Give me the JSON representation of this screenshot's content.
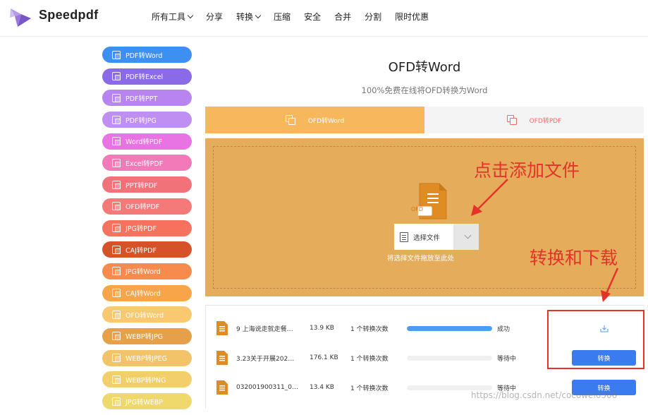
{
  "header": {
    "brand": "Speedpdf",
    "nav": [
      {
        "label": "所有工具",
        "dropdown": true
      },
      {
        "label": "分享",
        "dropdown": false
      },
      {
        "label": "转换",
        "dropdown": true
      },
      {
        "label": "压缩",
        "dropdown": false
      },
      {
        "label": "安全",
        "dropdown": false
      },
      {
        "label": "合并",
        "dropdown": false
      },
      {
        "label": "分割",
        "dropdown": false
      },
      {
        "label": "限时优惠",
        "dropdown": false
      }
    ]
  },
  "sidebar": {
    "items": [
      {
        "label": "PDF转Word",
        "color": "#3d8ff1"
      },
      {
        "label": "PDF转Excel",
        "color": "#8a6ae6"
      },
      {
        "label": "PDF转PPT",
        "color": "#b884f0"
      },
      {
        "label": "PDF转JPG",
        "color": "#bf8ff2"
      },
      {
        "label": "Word转PDF",
        "color": "#e873e3"
      },
      {
        "label": "Excel转PDF",
        "color": "#f27ab8"
      },
      {
        "label": "PPT转PDF",
        "color": "#f2727a"
      },
      {
        "label": "OFD转PDF",
        "color": "#f47a7a"
      },
      {
        "label": "JPG转PDF",
        "color": "#f6725e"
      },
      {
        "label": "CAJ转PDF",
        "color": "#d65329"
      },
      {
        "label": "JPG转Word",
        "color": "#f78a4d"
      },
      {
        "label": "CAJ转Word",
        "color": "#f7a548"
      },
      {
        "label": "OFD转Word",
        "color": "#fac870"
      },
      {
        "label": "WEBP转JPG",
        "color": "#e6a04a"
      },
      {
        "label": "WEBP转JPEG",
        "color": "#f2c368"
      },
      {
        "label": "WEBP转PNG",
        "color": "#f2cf6a"
      },
      {
        "label": "JPG转WEBP",
        "color": "#efd96c"
      }
    ]
  },
  "main": {
    "title": "OFD转Word",
    "subtitle": "100%免费在线将OFD转换为Word",
    "tabs": [
      {
        "label": "OFD转Word",
        "active": true
      },
      {
        "label": "OFD转PDF",
        "active": false
      }
    ],
    "upload": {
      "file_badge": "OFD",
      "select_label": "选择文件",
      "drop_hint": "将选择文件拖放至此处"
    }
  },
  "annotations": {
    "add_file": "点击添加文件",
    "convert_download": "转换和下载"
  },
  "files": [
    {
      "name": "9 上海说走就走餐…",
      "size": "13.9 KB",
      "count": "1 个转换次数",
      "progress": 1.0,
      "status": "成功",
      "action": "download"
    },
    {
      "name": "3.23关于开展202…",
      "size": "176.1 KB",
      "count": "1 个转换次数",
      "progress": 0.0,
      "status": "等待中",
      "action": "convert",
      "action_label": "转换"
    },
    {
      "name": "032001900311_0…",
      "size": "13.4 KB",
      "count": "1 个转换次数",
      "progress": 0.0,
      "status": "等待中",
      "action": "convert",
      "action_label": "转换"
    }
  ],
  "watermark": "https://blog.csdn.net/cocowei0306",
  "colors": {
    "accent_orange": "#f7b75d",
    "drop_zone": "#e5ad5b",
    "button_blue": "#3a7cf0",
    "annotation_red": "#e5332a"
  }
}
